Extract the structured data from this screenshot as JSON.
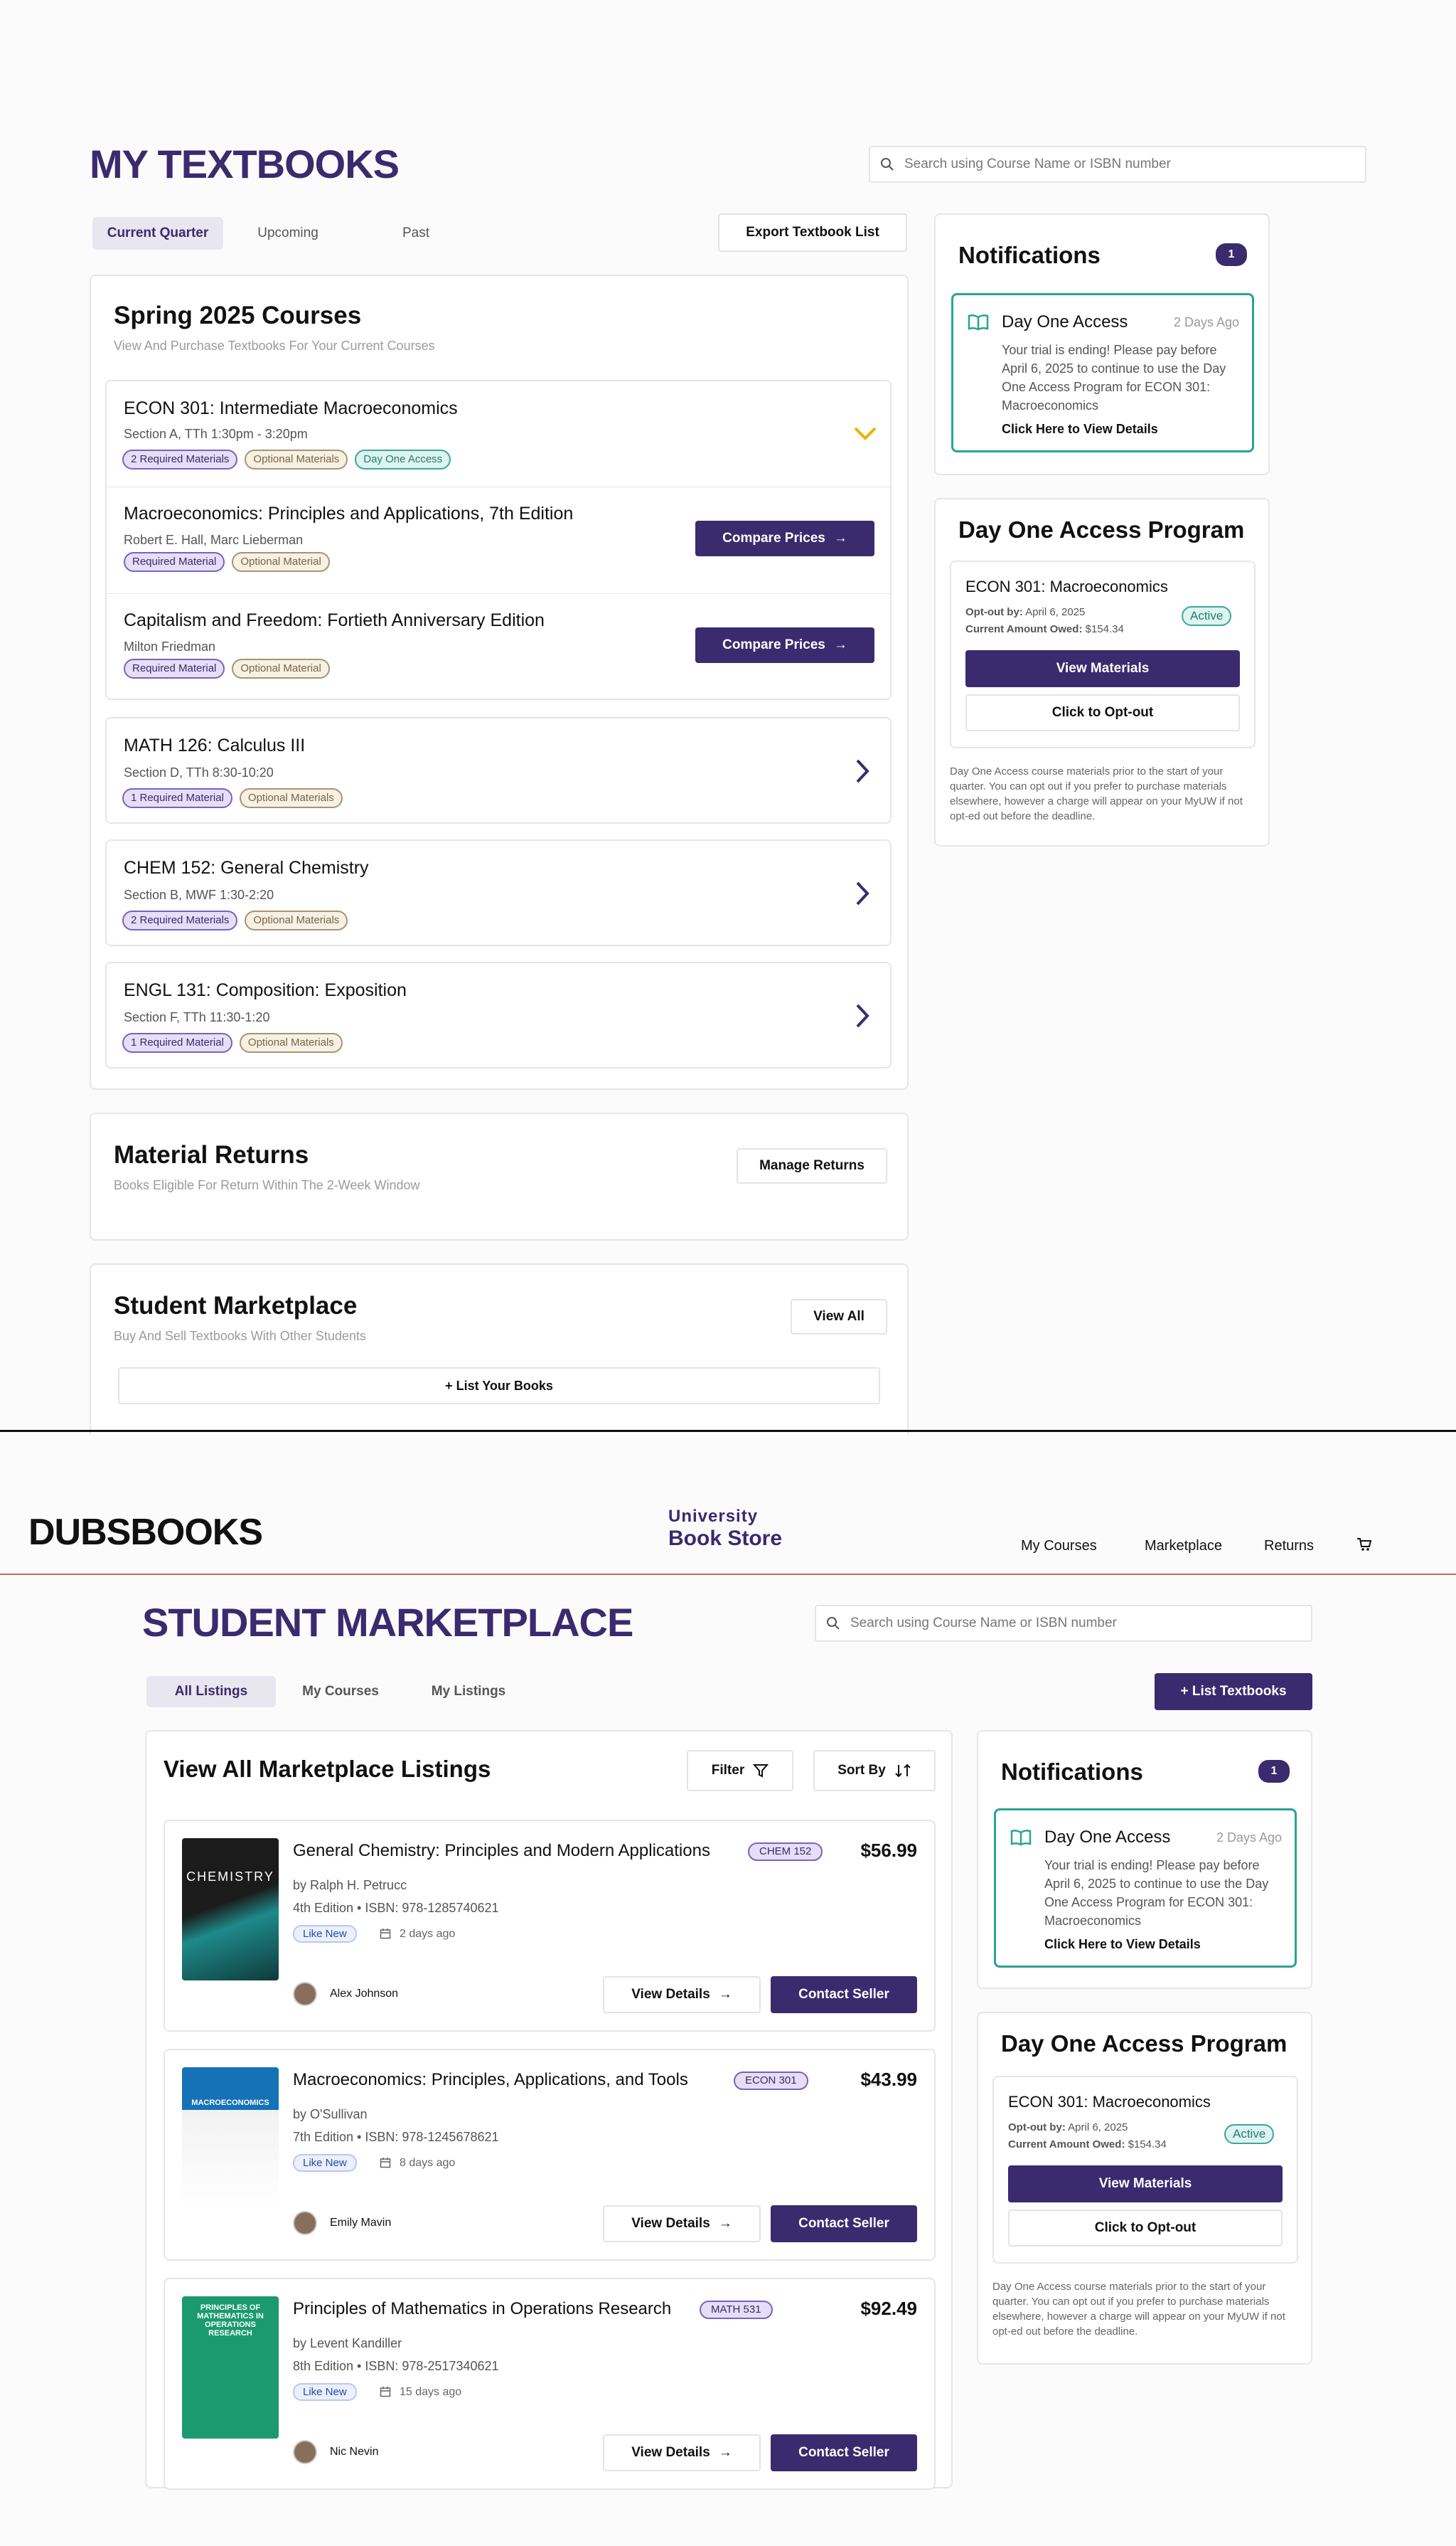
{
  "top": {
    "title": "MY TEXTBOOKS",
    "search_placeholder": "Search using Course Name or ISBN number",
    "tabs": [
      "Current Quarter",
      "Upcoming",
      "Past"
    ],
    "export_label": "Export Textbook List",
    "courses_card": {
      "title": "Spring 2025 Courses",
      "subtitle": "View And Purchase Textbooks For Your Current Courses",
      "expanded": {
        "name": "ECON 301: Intermediate Macroeconomics",
        "section": "Section A, TTh 1:30pm - 3:20pm",
        "pills": [
          "2 Required Materials",
          "Optional Materials",
          "Day One Access"
        ],
        "books": [
          {
            "title": "Macroeconomics: Principles and Applications, 7th Edition",
            "author": "Robert E. Hall, Marc Lieberman",
            "pills": [
              "Required Material",
              "Optional Material"
            ],
            "button": "Compare Prices"
          },
          {
            "title": "Capitalism and Freedom: Fortieth Anniversary Edition",
            "author": "Milton Friedman",
            "pills": [
              "Required Material",
              "Optional Material"
            ],
            "button": "Compare Prices"
          }
        ]
      },
      "collapsed": [
        {
          "name": "MATH 126: Calculus III",
          "section": "Section D, TTh 8:30-10:20",
          "pills": [
            "1 Required Material",
            "Optional Materials"
          ]
        },
        {
          "name": "CHEM 152: General Chemistry",
          "section": "Section B, MWF 1:30-2:20",
          "pills": [
            "2 Required Materials",
            "Optional Materials"
          ]
        },
        {
          "name": "ENGL 131: Composition: Exposition",
          "section": "Section F, TTh 11:30-1:20",
          "pills": [
            "1 Required Material",
            "Optional Materials"
          ]
        }
      ]
    },
    "returns": {
      "title": "Material Returns",
      "subtitle": "Books Eligible For Return Within The 2-Week Window",
      "button": "Manage Returns"
    },
    "marketplace": {
      "title": "Student Marketplace",
      "subtitle": "Buy And Sell Textbooks With Other Students",
      "button": "View All",
      "list_button": "+  List Your Books"
    },
    "notifications": {
      "title": "Notifications",
      "count": "1",
      "item_title": "Day One Access",
      "item_time": "2 Days Ago",
      "item_body": "Your trial is ending! Please pay before April 6, 2025 to continue to use the Day One Access Program for ECON 301: Macroeconomics",
      "item_link": "Click Here to View Details"
    },
    "doa": {
      "title": "Day One Access Program",
      "course": "ECON 301: Macroeconomics",
      "optout_label": "Opt-out by:",
      "optout_value": "April 6, 2025",
      "owed_label": "Current Amount Owed:",
      "owed_value": "$154.34",
      "status": "Active",
      "view_button": "View Materials",
      "optout_button": "Click to Opt-out",
      "note": "Day One Access course materials prior to the start of your quarter. You can opt out if you prefer to purchase materials elsewhere, however a charge will appear on your MyUW if not opt-ed out before the deadline."
    }
  },
  "bottom": {
    "brand": "DUBSBOOKS",
    "logo_line1": "University",
    "logo_line2": "Book Store",
    "nav": [
      "My Courses",
      "Marketplace",
      "Returns"
    ],
    "cart_icon": "cart-icon",
    "title": "STUDENT MARKETPLACE",
    "search_placeholder": "Search using Course Name or ISBN number",
    "tabs": [
      "All Listings",
      "My Courses",
      "My Listings"
    ],
    "list_button": "+ List Textbooks",
    "listings_title": "View All Marketplace Listings",
    "filter_label": "Filter",
    "sort_label": "Sort By",
    "listings": [
      {
        "title": "General Chemistry: Principles and Modern Applications",
        "tag": "CHEM 152",
        "price": "$56.99",
        "author": "by  Ralph H. Petrucc",
        "edition": "4th Edition • ISBN: 978-1285740621",
        "condition": "Like New",
        "posted": "2 days ago",
        "seller": "Alex Johnson",
        "cover_text": "CHEMISTRY",
        "details": "View Details",
        "contact": "Contact Seller"
      },
      {
        "title": "Macroeconomics: Principles, Applications, and Tools",
        "tag": "ECON 301",
        "price": "$43.99",
        "author": "by  O'Sullivan",
        "edition": "7th Edition • ISBN: 978-1245678621",
        "condition": "Like New",
        "posted": "8 days ago",
        "seller": "Emily Mavin",
        "cover_text": "MACROECONOMICS",
        "details": "View Details",
        "contact": "Contact Seller"
      },
      {
        "title": "Principles of Mathematics in Operations Research",
        "tag": "MATH 531",
        "price": "$92.49",
        "author": "by  Levent Kandiller",
        "edition": "8th Edition • ISBN: 978-2517340621",
        "condition": "Like New",
        "posted": "15 days ago",
        "seller": "Nic Nevin",
        "cover_text": "PRINCIPLES OF MATHEMATICS IN OPERATIONS RESEARCH",
        "details": "View Details",
        "contact": "Contact Seller"
      }
    ],
    "notifications": {
      "title": "Notifications",
      "count": "1",
      "item_title": "Day One Access",
      "item_time": "2 Days Ago",
      "item_body": "Your trial is ending! Please pay before April 6, 2025 to continue to use the Day One Access Program for ECON 301: Macroeconomics",
      "item_link": "Click Here to View Details"
    },
    "doa": {
      "title": "Day One Access Program",
      "course": "ECON 301: Macroeconomics",
      "optout_label": "Opt-out by:",
      "optout_value": "April 6, 2025",
      "owed_label": "Current Amount Owed:",
      "owed_value": "$154.34",
      "status": "Active",
      "view_button": "View Materials",
      "optout_button": "Click to Opt-out",
      "note": "Day One Access course materials prior to the start of your quarter. You can opt out if you prefer to purchase materials elsewhere, however a charge will appear on your MyUW if not opt-ed out before the deadline."
    }
  },
  "colors": {
    "accent": "#3a2a6e",
    "teal": "#2aa394",
    "divider": "#c46b4a"
  }
}
